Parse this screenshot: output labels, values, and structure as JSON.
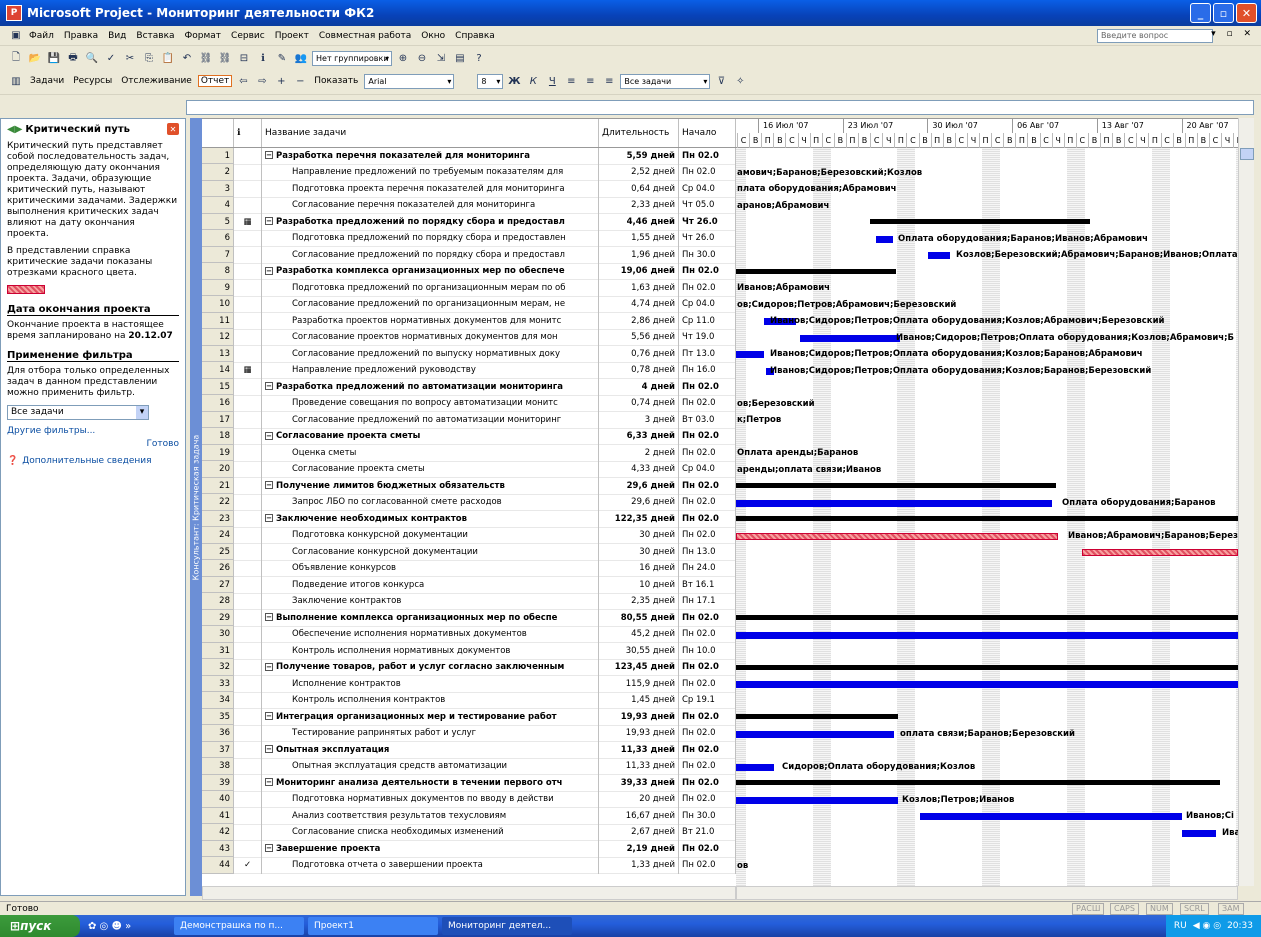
{
  "window": {
    "title": "Microsoft Project - Мониторинг деятельности ФК2"
  },
  "menu": {
    "items": [
      "Файл",
      "Правка",
      "Вид",
      "Вставка",
      "Формат",
      "Сервис",
      "Проект",
      "Совместная работа",
      "Окно",
      "Справка"
    ],
    "ask_placeholder": "Введите вопрос"
  },
  "toolbar1": {
    "grouping": "Нет группировки"
  },
  "toolbar2": {
    "tasks": "Задачи",
    "resources": "Ресурсы",
    "tracking": "Отслеживание",
    "report": "Отчет",
    "show": "Показать",
    "font": "Arial",
    "size": "8",
    "filter": "Все задачи"
  },
  "sidepane": {
    "title": "Критический путь",
    "p1": "Критический путь представляет собой последовательность задач, определяющую дату окончания проекта. Задачи, образующие критический путь, называют критическими задачами. Задержки выполнения критических задач влияют на дату окончания проекта.",
    "p2": "В представлении справка критические задачи показаны отрезками красного цвета.",
    "h_end": "Дата окончания проекта",
    "p3": "Окончание проекта в настоящее время запланировано на",
    "end_date": "20.12.07",
    "h_filter": "Применение фильтра",
    "p4": "Для отбора только определенных задач в данном представлении можно применить фильтр.",
    "filter_value": "Все задачи",
    "other_filters": "Другие фильтры...",
    "done": "Готово",
    "more_info": "Дополнительные сведения"
  },
  "vstrip": "Консультант: Критическая задача",
  "grid": {
    "headers": {
      "ind": "ℹ",
      "name": "Название задачи",
      "dur": "Длительность",
      "start": "Начало"
    },
    "rows": [
      {
        "id": "1",
        "name": "Разработка перечня показателей для мониторинга",
        "dur": "5,59 дней",
        "start": "Пн 02.0",
        "s": true
      },
      {
        "id": "2",
        "name": "Направление предложений по требуемым показателям для",
        "dur": "2,52 дней",
        "start": "Пн 02.0"
      },
      {
        "id": "3",
        "name": "Подготовка проекта перечня показателей для мониторинга",
        "dur": "0,64 дней",
        "start": "Ср 04.0"
      },
      {
        "id": "4",
        "name": "Согласование перечня показателей для мониторинга",
        "dur": "2,33 дней",
        "start": "Чт 05.0"
      },
      {
        "id": "5",
        "name": "Разработка предложений по порядку сбора и предоставл",
        "dur": "4,46 дней",
        "start": "Чт 26.0",
        "s": true,
        "ind": "▦"
      },
      {
        "id": "6",
        "name": "Подготовка предложений по порядку сбора и предоставлен",
        "dur": "1,55 дней",
        "start": "Чт 26.0"
      },
      {
        "id": "7",
        "name": "Согласование предложений по порядку сбора и предоставл",
        "dur": "1,96 дней",
        "start": "Пн 30.0"
      },
      {
        "id": "8",
        "name": "Разработка комплекса организационных мер по обеспече",
        "dur": "19,06 дней",
        "start": "Пн 02.0",
        "s": true
      },
      {
        "id": "9",
        "name": "Подготовка предложений по организационным мерам по об",
        "dur": "1,63 дней",
        "start": "Пн 02.0"
      },
      {
        "id": "10",
        "name": "Согласование предложений по организационным мерам, не",
        "dur": "4,74 дней",
        "start": "Ср 04.0"
      },
      {
        "id": "11",
        "name": "Разработка проектов нормативных документов для монитс",
        "dur": "2,86 дней",
        "start": "Ср 11.0"
      },
      {
        "id": "12",
        "name": "Согласование проектов нормативных документов для мон",
        "dur": "5,56 дней",
        "start": "Чт 19.0"
      },
      {
        "id": "13",
        "name": "Согласование предложений по выпуску нормативных доку",
        "dur": "0,76 дней",
        "start": "Пт 13.0"
      },
      {
        "id": "14",
        "name": "Направление предложений руководству",
        "dur": "0,78 дней",
        "start": "Пн 16.0",
        "ind": "▦"
      },
      {
        "id": "15",
        "name": "Разработка предложений по автоматизации мониторинга",
        "dur": "4 дней",
        "start": "Пн 02.0",
        "s": true
      },
      {
        "id": "16",
        "name": "Проведение совещания по вопросу автоматизации монитс",
        "dur": "0,74 дней",
        "start": "Пн 02.0"
      },
      {
        "id": "17",
        "name": "Согласование предложений по автоматизации мониторинг",
        "dur": "3 дней",
        "start": "Вт 03.0"
      },
      {
        "id": "18",
        "name": "Согласование проекта сметы",
        "dur": "6,33 дней",
        "start": "Пн 02.0",
        "s": true
      },
      {
        "id": "19",
        "name": "Оценка сметы",
        "dur": "2 дней",
        "start": "Пн 02.0"
      },
      {
        "id": "20",
        "name": "Согласование проекта сметы",
        "dur": "4,33 дней",
        "start": "Ср 04.0"
      },
      {
        "id": "21",
        "name": "Получение лимитов бюджетных обязательств",
        "dur": "29,6 дней",
        "start": "Пн 02.0",
        "s": true
      },
      {
        "id": "22",
        "name": "Запрос ЛБО по согласованной смете расходов",
        "dur": "29,6 дней",
        "start": "Пн 02.0"
      },
      {
        "id": "23",
        "name": "Заключение необходимых контрактов",
        "dur": "122,35 дней",
        "start": "Пн 02.0",
        "s": true
      },
      {
        "id": "24",
        "name": "Подготовка конкурсной документации",
        "dur": "30 дней",
        "start": "Пн 02.0"
      },
      {
        "id": "25",
        "name": "Согласование конкурсной документации",
        "dur": "30 дней",
        "start": "Пн 13.0"
      },
      {
        "id": "26",
        "name": "Объявление конкурсов",
        "dur": "16 дней",
        "start": "Пн 24.0"
      },
      {
        "id": "27",
        "name": "Подведение итогов конкурса",
        "dur": "10 дней",
        "start": "Вт 16.1"
      },
      {
        "id": "28",
        "name": "Заключение контрактов",
        "dur": "2,35 дней",
        "start": "Пн 17.1"
      },
      {
        "id": "29",
        "name": "Выполнение комплекса организационных мер по обеспе",
        "dur": "80,55 дней",
        "start": "Пн 02.0",
        "s": true
      },
      {
        "id": "30",
        "name": "Обеспечение исполнения нормативных документов",
        "dur": "45,2 дней",
        "start": "Пн 02.0"
      },
      {
        "id": "31",
        "name": "Контроль исполнения нормативных документов",
        "dur": "30,55 дней",
        "start": "Пн 10.0"
      },
      {
        "id": "32",
        "name": "Получение товаров, работ и услуг согласно заключенным",
        "dur": "123,45 дней",
        "start": "Пн 02.0",
        "s": true
      },
      {
        "id": "33",
        "name": "Исполнение контрактов",
        "dur": "115,9 дней",
        "start": "Пн 02.0"
      },
      {
        "id": "34",
        "name": "Контроль исполнения контрактов",
        "dur": "1,45 дней",
        "start": "Ср 19.1"
      },
      {
        "id": "35",
        "name": "Интеграция организационных мер и тестирование работ",
        "dur": "19,93 дней",
        "start": "Пн 02.0",
        "s": true
      },
      {
        "id": "36",
        "name": "Тестирование рапринятых работ и услуг",
        "dur": "19,93 дней",
        "start": "Пн 02.0"
      },
      {
        "id": "37",
        "name": "Опытная эксплуатация",
        "dur": "11,33 дней",
        "start": "Пн 02.0",
        "s": true
      },
      {
        "id": "38",
        "name": "Опытная эксплуатация средств автоматизации",
        "dur": "11,33 дней",
        "start": "Пн 02.0"
      },
      {
        "id": "39",
        "name": "Мониторинг анализа деятельности в течении первого отч",
        "dur": "39,33 дней",
        "start": "Пн 02.0",
        "s": true
      },
      {
        "id": "40",
        "name": "Подготовка нормативных документов по вводу в действи",
        "dur": "20 дней",
        "start": "Пн 02.0"
      },
      {
        "id": "41",
        "name": "Анализ соответствия результатов техусловиям",
        "dur": "16,67 дней",
        "start": "Пн 30.0"
      },
      {
        "id": "42",
        "name": "Согласование списка необходимых изменений",
        "dur": "2,67 дней",
        "start": "Вт 21.0"
      },
      {
        "id": "43",
        "name": "Завершение проекта",
        "dur": "2,19 дней",
        "start": "Пн 02.0",
        "s": true
      },
      {
        "id": "44",
        "name": "Подготовка отчета о завершении проекта",
        "dur": "1,33 дней",
        "start": "Пн 02.0",
        "ind": "✓"
      }
    ]
  },
  "gantt": {
    "weeks": [
      "16 Июл '07",
      "23 Июл '07",
      "30 Июл '07",
      "06 Авг '07",
      "13 Авг '07",
      "20 Авг '07"
    ],
    "days": [
      "С",
      "В",
      "П",
      "В",
      "С",
      "Ч",
      "П"
    ],
    "labels": [
      {
        "r": 1,
        "t": "амович;Баранов;Березовский;Козлов"
      },
      {
        "r": 2,
        "t": "плата оборудования;Абрамович"
      },
      {
        "r": 3,
        "t": "аранов;Абрамович"
      },
      {
        "r": 5,
        "t": "Оплата оборудования;Баранов;Иванов;Абрамович"
      },
      {
        "r": 6,
        "t": "Козлов;Березовский;Абрамович;Баранов;Иванов;Оплата"
      },
      {
        "r": 8,
        "t": "Иванов;Абрамович"
      },
      {
        "r": 9,
        "t": "ов;Сидоров;Петров;Абрамович;Березовский"
      },
      {
        "r": 10,
        "t": "Иванов;Сидоров;Петров;Оплата оборудования;Козлов;Абрамович;Березовский"
      },
      {
        "r": 11,
        "t": "Иванов;Сидоров;Петров;Оплата оборудования;Козлов;Абрамович;Б"
      },
      {
        "r": 12,
        "t": "Иванов;Сидоров;Петров;Оплата оборудования;Козлов;Баранов;Абрамович"
      },
      {
        "r": 13,
        "t": "Иванов;Сидоров;Петров;Оплата оборудования;Козлов;Баранов;Березовский"
      },
      {
        "r": 15,
        "t": "ов;Березовский"
      },
      {
        "r": 16,
        "t": "к;Петров"
      },
      {
        "r": 18,
        "t": "Оплата аренды;Баранов"
      },
      {
        "r": 19,
        "t": "аренды;оплата связи;Иванов"
      },
      {
        "r": 21,
        "t": "Оплата оборудования;Баранов"
      },
      {
        "r": 23,
        "t": "Иванов;Абрамович;Баранов;Берез"
      },
      {
        "r": 35,
        "t": "оплата связи;Баранов;Березовский"
      },
      {
        "r": 37,
        "t": "Сидоров;Оплата оборудования;Козлов"
      },
      {
        "r": 39,
        "t": "Козлов;Петров;Иванов"
      },
      {
        "r": 40,
        "t": "Иванов;Сі"
      },
      {
        "r": 41,
        "t": "Ива"
      },
      {
        "r": 43,
        "t": "ов"
      }
    ]
  },
  "status": {
    "text": "Готово",
    "ind": [
      "РАСШ",
      "CAPS",
      "NUM",
      "SCRL",
      "ЗАМ"
    ]
  },
  "taskbar": {
    "start": "пуск",
    "tasks": [
      "Демонстрашка по п...",
      "Проект1",
      "Мониторинг деятел..."
    ],
    "lang": "RU",
    "clock": "20:33"
  }
}
